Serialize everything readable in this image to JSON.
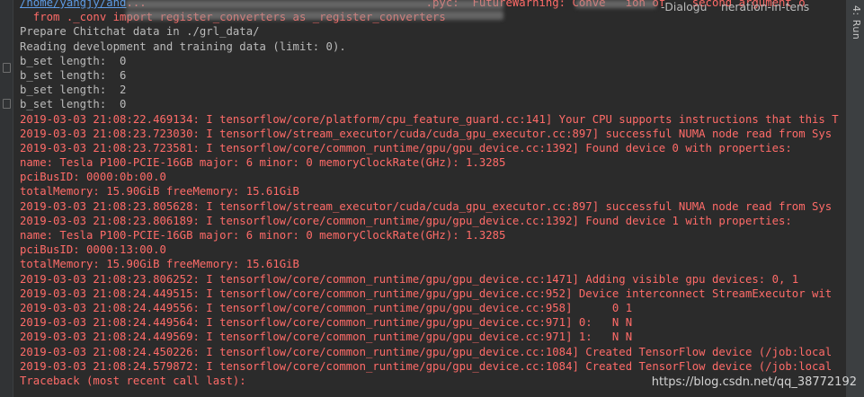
{
  "title_fragment": "-Dialogu    neration-in-tens",
  "right_tool": {
    "label": "4: Run"
  },
  "watermark": "https://blog.csdn.net/qq_38772192",
  "console_lines": [
    {
      "text": "/home/yangjy/and...                                          .pyc:  FutureWarning: Conve   ion of    second argument o",
      "kind": "stderr",
      "link_prefix": "/home/yangjy/and"
    },
    {
      "text": "  from ._conv import register_converters as _register_converters",
      "kind": "stderr"
    },
    {
      "text": "Prepare Chitchat data in ./grl_data/",
      "kind": "stdout"
    },
    {
      "text": "Reading development and training data (limit: 0).",
      "kind": "stdout"
    },
    {
      "text": "b_set length:  0",
      "kind": "stdout"
    },
    {
      "text": "b_set length:  6",
      "kind": "stdout"
    },
    {
      "text": "b_set length:  2",
      "kind": "stdout"
    },
    {
      "text": "b_set length:  0",
      "kind": "stdout"
    },
    {
      "text": "2019-03-03 21:08:22.469134: I tensorflow/core/platform/cpu_feature_guard.cc:141] Your CPU supports instructions that this T",
      "kind": "stderr"
    },
    {
      "text": "2019-03-03 21:08:23.723030: I tensorflow/stream_executor/cuda/cuda_gpu_executor.cc:897] successful NUMA node read from Sys",
      "kind": "stderr"
    },
    {
      "text": "2019-03-03 21:08:23.723581: I tensorflow/core/common_runtime/gpu/gpu_device.cc:1392] Found device 0 with properties:",
      "kind": "stderr"
    },
    {
      "text": "name: Tesla P100-PCIE-16GB major: 6 minor: 0 memoryClockRate(GHz): 1.3285",
      "kind": "stderr"
    },
    {
      "text": "pciBusID: 0000:0b:00.0",
      "kind": "stderr"
    },
    {
      "text": "totalMemory: 15.90GiB freeMemory: 15.61GiB",
      "kind": "stderr"
    },
    {
      "text": "2019-03-03 21:08:23.805628: I tensorflow/stream_executor/cuda/cuda_gpu_executor.cc:897] successful NUMA node read from Sys",
      "kind": "stderr"
    },
    {
      "text": "2019-03-03 21:08:23.806189: I tensorflow/core/common_runtime/gpu/gpu_device.cc:1392] Found device 1 with properties:",
      "kind": "stderr"
    },
    {
      "text": "name: Tesla P100-PCIE-16GB major: 6 minor: 0 memoryClockRate(GHz): 1.3285",
      "kind": "stderr"
    },
    {
      "text": "pciBusID: 0000:13:00.0",
      "kind": "stderr"
    },
    {
      "text": "totalMemory: 15.90GiB freeMemory: 15.61GiB",
      "kind": "stderr"
    },
    {
      "text": "2019-03-03 21:08:23.806252: I tensorflow/core/common_runtime/gpu/gpu_device.cc:1471] Adding visible gpu devices: 0, 1",
      "kind": "stderr"
    },
    {
      "text": "2019-03-03 21:08:24.449515: I tensorflow/core/common_runtime/gpu/gpu_device.cc:952] Device interconnect StreamExecutor wit",
      "kind": "stderr"
    },
    {
      "text": "2019-03-03 21:08:24.449556: I tensorflow/core/common_runtime/gpu/gpu_device.cc:958]      0 1",
      "kind": "stderr"
    },
    {
      "text": "2019-03-03 21:08:24.449564: I tensorflow/core/common_runtime/gpu/gpu_device.cc:971] 0:   N N",
      "kind": "stderr"
    },
    {
      "text": "2019-03-03 21:08:24.449569: I tensorflow/core/common_runtime/gpu/gpu_device.cc:971] 1:   N N",
      "kind": "stderr"
    },
    {
      "text": "2019-03-03 21:08:24.450226: I tensorflow/core/common_runtime/gpu/gpu_device.cc:1084] Created TensorFlow device (/job:local",
      "kind": "stderr"
    },
    {
      "text": "2019-03-03 21:08:24.579872: I tensorflow/core/common_runtime/gpu/gpu_device.cc:1084] Created TensorFlow device (/job:local",
      "kind": "stderr"
    },
    {
      "text": "Traceback (most recent call last):",
      "kind": "stderr"
    }
  ],
  "colors": {
    "background": "#2b2b2b",
    "stdout": "#bbbbbb",
    "stderr": "#ff6b68",
    "link": "#5e9ce6"
  }
}
